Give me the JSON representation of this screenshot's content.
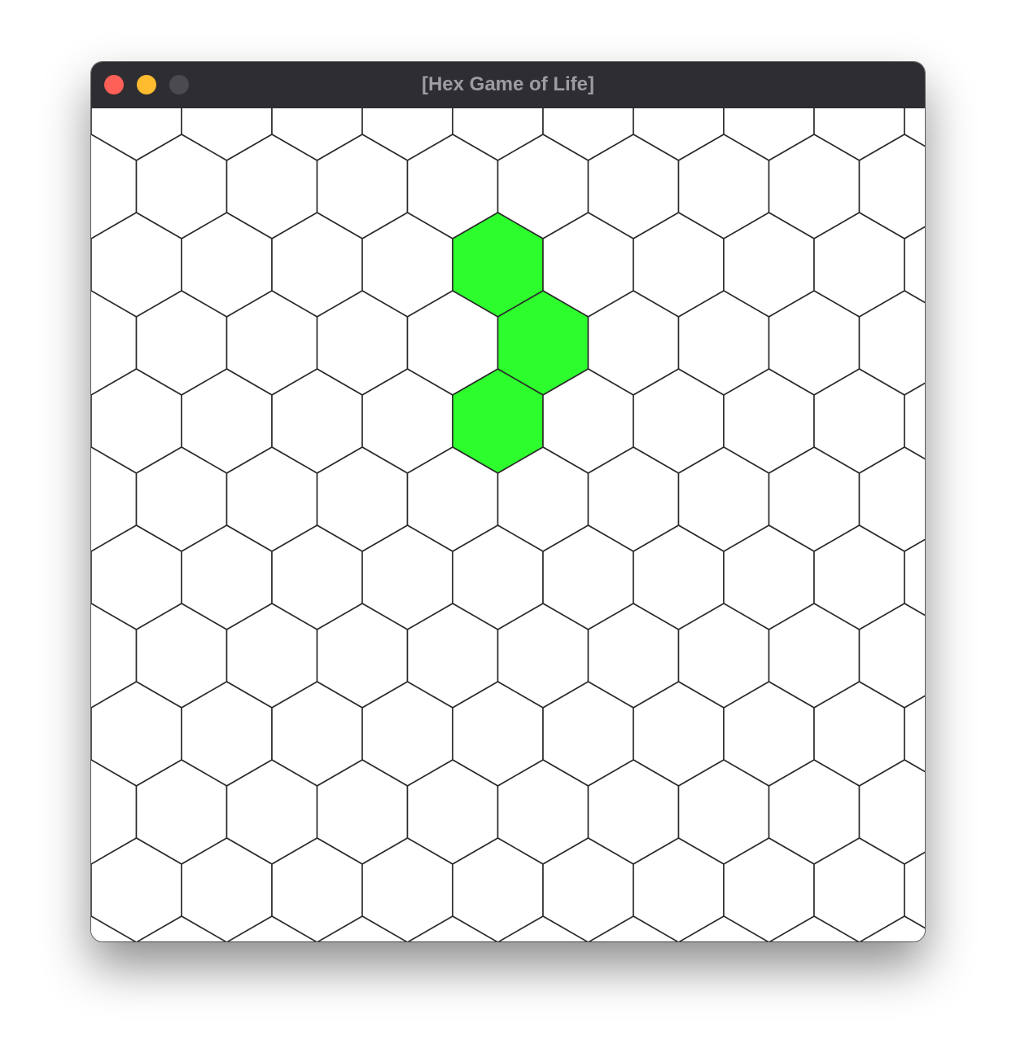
{
  "window": {
    "title": "[Hex Game of Life]",
    "controls": [
      "close",
      "minimize",
      "zoom"
    ]
  },
  "board": {
    "cell_shape": "hexagon",
    "live_color": "#2dfd2d",
    "dead_color": "#ffffff",
    "grid_line_color": "#2a2a2a",
    "live_cells": [
      {
        "row": 2,
        "col": 4
      },
      {
        "row": 3,
        "col": 5
      },
      {
        "row": 4,
        "col": 4
      }
    ]
  }
}
